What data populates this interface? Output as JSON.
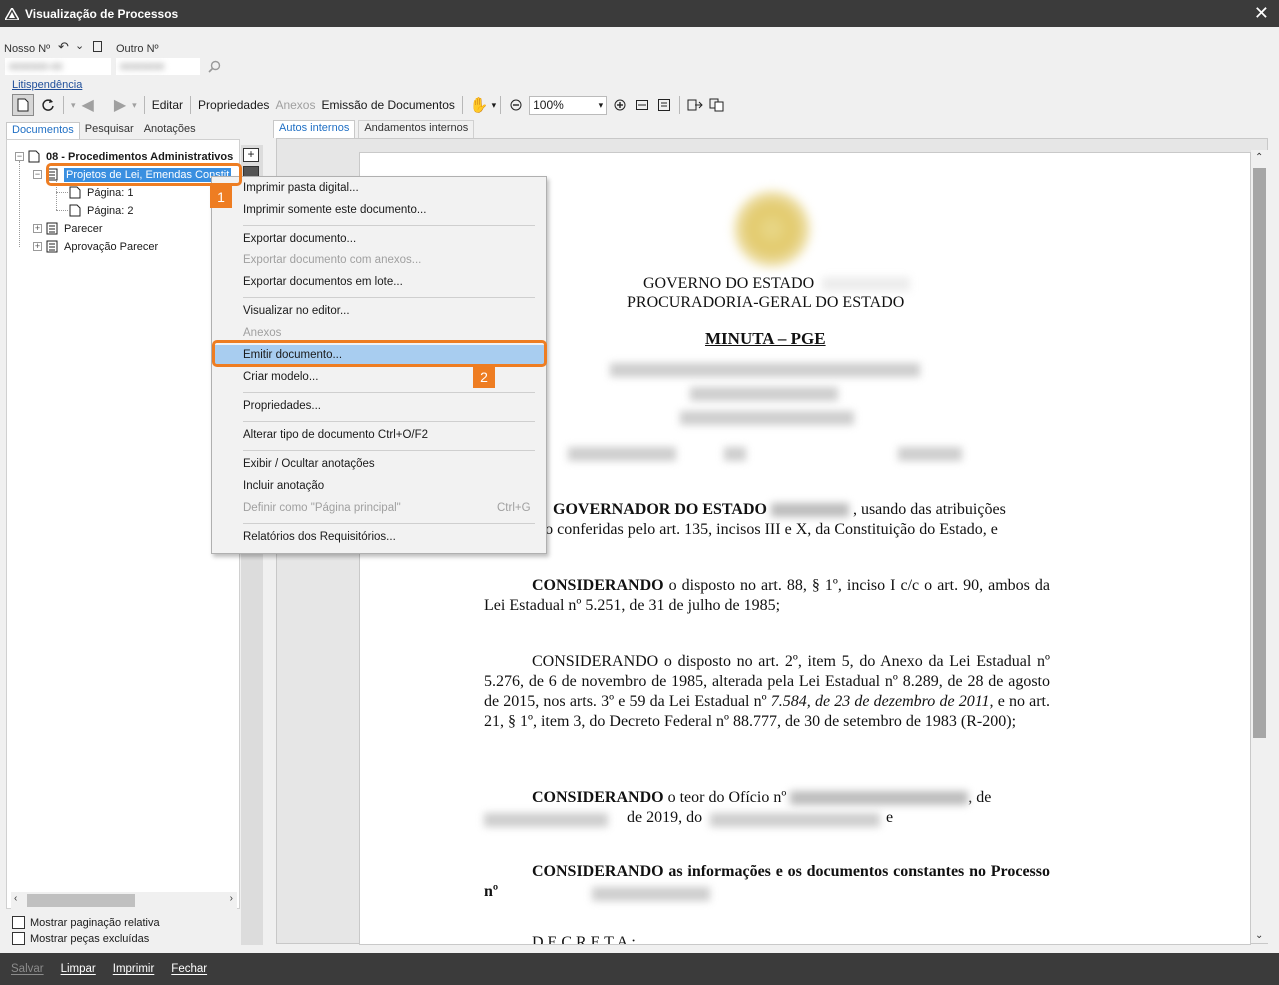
{
  "window": {
    "title": "Visualização de Processos",
    "close_glyph": "✕"
  },
  "header": {
    "nosso_label": "Nosso Nº",
    "outro_label": "Outro Nº",
    "nosso_value": "0000000-00",
    "outro_value": "00000000",
    "litispendencia": "Litispendência"
  },
  "toolbar": {
    "editar": "Editar",
    "propriedades": "Propriedades",
    "anexos": "Anexos",
    "emissao": "Emissão de Documentos",
    "zoom": "100%"
  },
  "left_tabs": [
    "Documentos",
    "Pesquisar",
    "Anotações"
  ],
  "right_tabs": [
    "Autos internos",
    "Andamentos internos"
  ],
  "tree": {
    "root": "08 - Procedimentos Administrativos",
    "item1": "Projetos de Lei, Emendas Constit",
    "page1": "Página: 1",
    "page2": "Página: 2",
    "item2": "Parecer",
    "item3": "Aprovação Parecer"
  },
  "options": {
    "paginacao": "Mostrar paginação relativa",
    "excluidas": "Mostrar peças excluídas"
  },
  "context_menu": {
    "items": [
      "Imprimir pasta digital...",
      "Imprimir somente este documento...",
      "Exportar documento...",
      "Exportar documento com anexos...",
      "Exportar documentos em lote...",
      "Visualizar no editor...",
      "Anexos",
      "Emitir documento...",
      "Criar modelo...",
      "Propriedades...",
      "Alterar tipo de documento Ctrl+O/F2",
      "Exibir / Ocultar anotações",
      "Incluir anotação",
      "Definir como \"Página principal\"",
      "Relatórios dos Requisitórios..."
    ],
    "shortcut_definir": "Ctrl+G"
  },
  "callouts": {
    "one": "1",
    "two": "2"
  },
  "document": {
    "gov1": "GOVERNO DO ESTADO",
    "gov2": "PROCURADORIA-GERAL DO ESTADO",
    "minuta": "MINUTA – PGE",
    "p1_bold": "GOVERNADOR DO ESTADO",
    "p1_rest": ", usando das atribuições",
    "p1_line2": "ão conferidas pelo art. 135, incisos III e X, da Constituição do Estado, e",
    "p2_bold": "CONSIDERANDO",
    "p2_rest": " o disposto no art. 88, § 1º, inciso I c/c o art. 90, ambos da Lei Estadual nº 5.251, de 31 de julho de 1985;",
    "p3_a": "CONSIDERANDO o disposto no art. 2º, item 5, do Anexo da Lei Estadual nº 5.276, de 6 de novembro de 1985, alterada pela Lei Estadual nº 8.289, de 28 de agosto de 2015, nos arts. 3º e 59 da Lei Estadual nº ",
    "p3_italic": "7.584, de 23 de dezembro de 2011,",
    "p3_b": " e no art. 21, § 1º, item 3, do Decreto Federal nº 88.777, de 30 de setembro de 1983 (R-200);",
    "p4_bold": "CONSIDERANDO",
    "p4_rest": " o teor do Ofício nº",
    "p4_de": ", de",
    "p4_line2": "de 2019, do",
    "p4_e": "e",
    "p5_bold": "CONSIDERANDO as informações e os documentos constantes no Processo nº",
    "decreta": "D E C R E T A :"
  },
  "statusbar": {
    "salvar": "Salvar",
    "limpar": "Limpar",
    "imprimir": "Imprimir",
    "fechar": "Fechar"
  }
}
